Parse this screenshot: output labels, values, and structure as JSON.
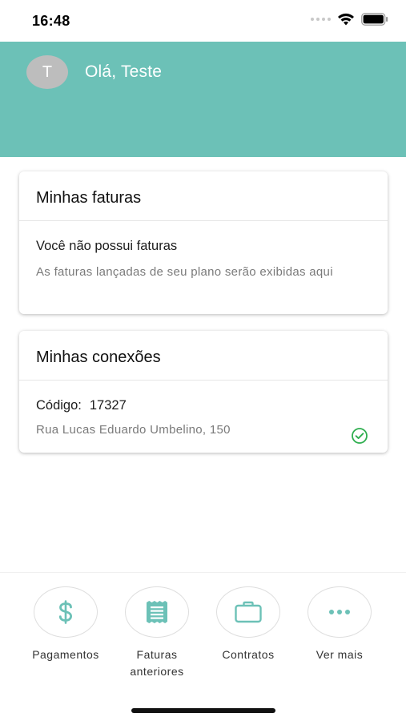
{
  "status_bar": {
    "time": "16:48"
  },
  "header": {
    "avatar_initial": "T",
    "greeting": "Olá, Teste",
    "background_color": "#6cc1b7"
  },
  "invoices_card": {
    "title": "Minhas faturas",
    "empty_heading": "Você não possui faturas",
    "empty_description": "As faturas lançadas de seu plano serão exibidas aqui"
  },
  "connections_card": {
    "title": "Minhas conexões",
    "code_label": "Código:",
    "code_value": "17327",
    "address": "Rua Lucas Eduardo Umbelino, 150",
    "status_icon": "check-circle-icon",
    "status_color": "#2eae4f"
  },
  "bottom_nav": {
    "accent_color": "#6cc1b7",
    "items": [
      {
        "label": "Pagamentos",
        "icon": "dollar-icon"
      },
      {
        "label": "Faturas anteriores",
        "icon": "receipt-icon"
      },
      {
        "label": "Contratos",
        "icon": "briefcase-icon"
      },
      {
        "label": "Ver mais",
        "icon": "more-icon"
      }
    ]
  }
}
